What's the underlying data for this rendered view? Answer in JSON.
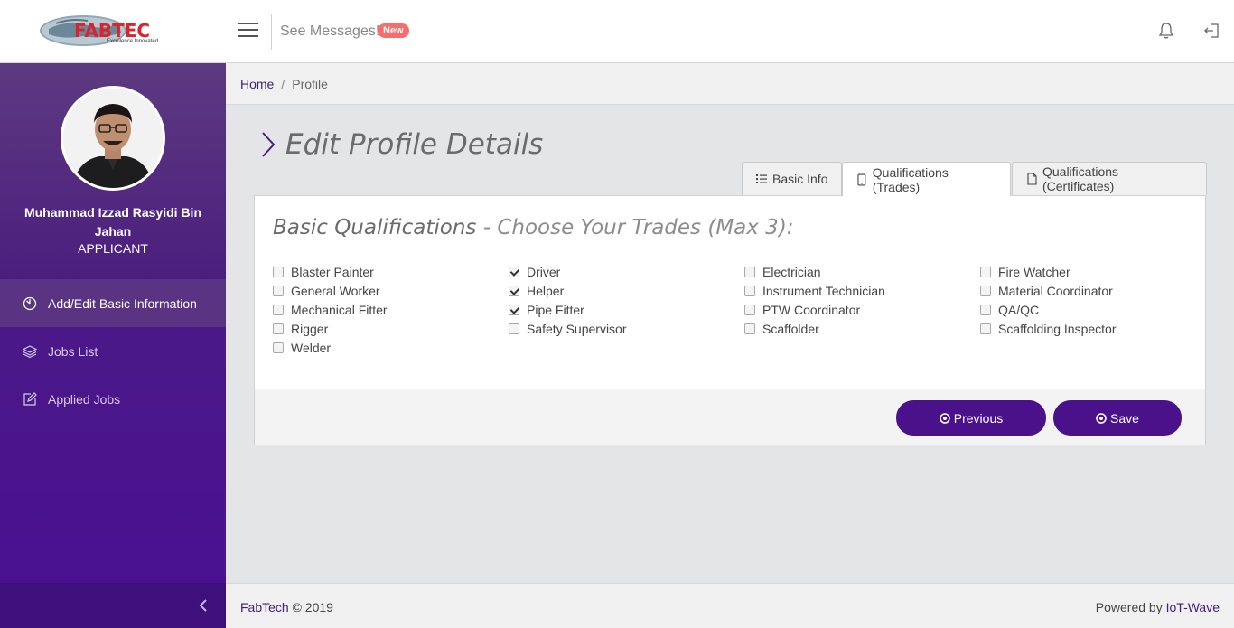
{
  "header": {
    "logo_text": "FABTEC",
    "logo_tagline": "Excellence Innovated",
    "messages_label": "See Messages!",
    "messages_badge": "New",
    "icons": [
      "menu-icon",
      "bell-icon",
      "logout-icon"
    ]
  },
  "sidebar": {
    "user_name": "Muhammad Izzad Rasyidi Bin Jahan",
    "user_role": "APPLICANT",
    "items": [
      {
        "label": "Add/Edit Basic Information",
        "icon": "clock-icon",
        "active": true
      },
      {
        "label": "Jobs List",
        "icon": "layers-icon",
        "active": false
      },
      {
        "label": "Applied Jobs",
        "icon": "edit-icon",
        "active": false
      }
    ]
  },
  "breadcrumb": {
    "home": "Home",
    "separator": "/",
    "current": "Profile"
  },
  "page": {
    "title": "Edit Profile Details"
  },
  "tabs": [
    {
      "label": "Basic Info",
      "icon": "list-icon",
      "active": false
    },
    {
      "label": "Qualifications (Trades)",
      "icon": "tablet-icon",
      "active": true
    },
    {
      "label": "Qualifications (Certificates)",
      "icon": "document-icon",
      "active": false
    }
  ],
  "card": {
    "heading_strong": "Basic Qualifications",
    "heading_light": " - Choose Your Trades (Max 3):",
    "trades": [
      {
        "label": "Blaster Painter",
        "checked": false
      },
      {
        "label": "Driver",
        "checked": true
      },
      {
        "label": "Electrician",
        "checked": false
      },
      {
        "label": "Fire Watcher",
        "checked": false
      },
      {
        "label": "General Worker",
        "checked": false
      },
      {
        "label": "Helper",
        "checked": true
      },
      {
        "label": "Instrument Technician",
        "checked": false
      },
      {
        "label": "Material Coordinator",
        "checked": false
      },
      {
        "label": "Mechanical Fitter",
        "checked": false
      },
      {
        "label": "Pipe Fitter",
        "checked": true
      },
      {
        "label": "PTW Coordinator",
        "checked": false
      },
      {
        "label": "QA/QC",
        "checked": false
      },
      {
        "label": "Rigger",
        "checked": false
      },
      {
        "label": "Safety Supervisor",
        "checked": false
      },
      {
        "label": "Scaffolder",
        "checked": false
      },
      {
        "label": "Scaffolding Inspector",
        "checked": false
      },
      {
        "label": "Welder",
        "checked": false
      }
    ],
    "previous_label": "Previous",
    "save_label": "Save"
  },
  "footer": {
    "brand": "FabTech",
    "copyright": "© 2019",
    "powered_by": "Powered by",
    "powered_link": "IoT-Wave"
  },
  "colors": {
    "primary": "#4a118a",
    "sidebar_top": "#5d3a80",
    "badge": "#f86c6b",
    "link": "#3f1e7a"
  }
}
